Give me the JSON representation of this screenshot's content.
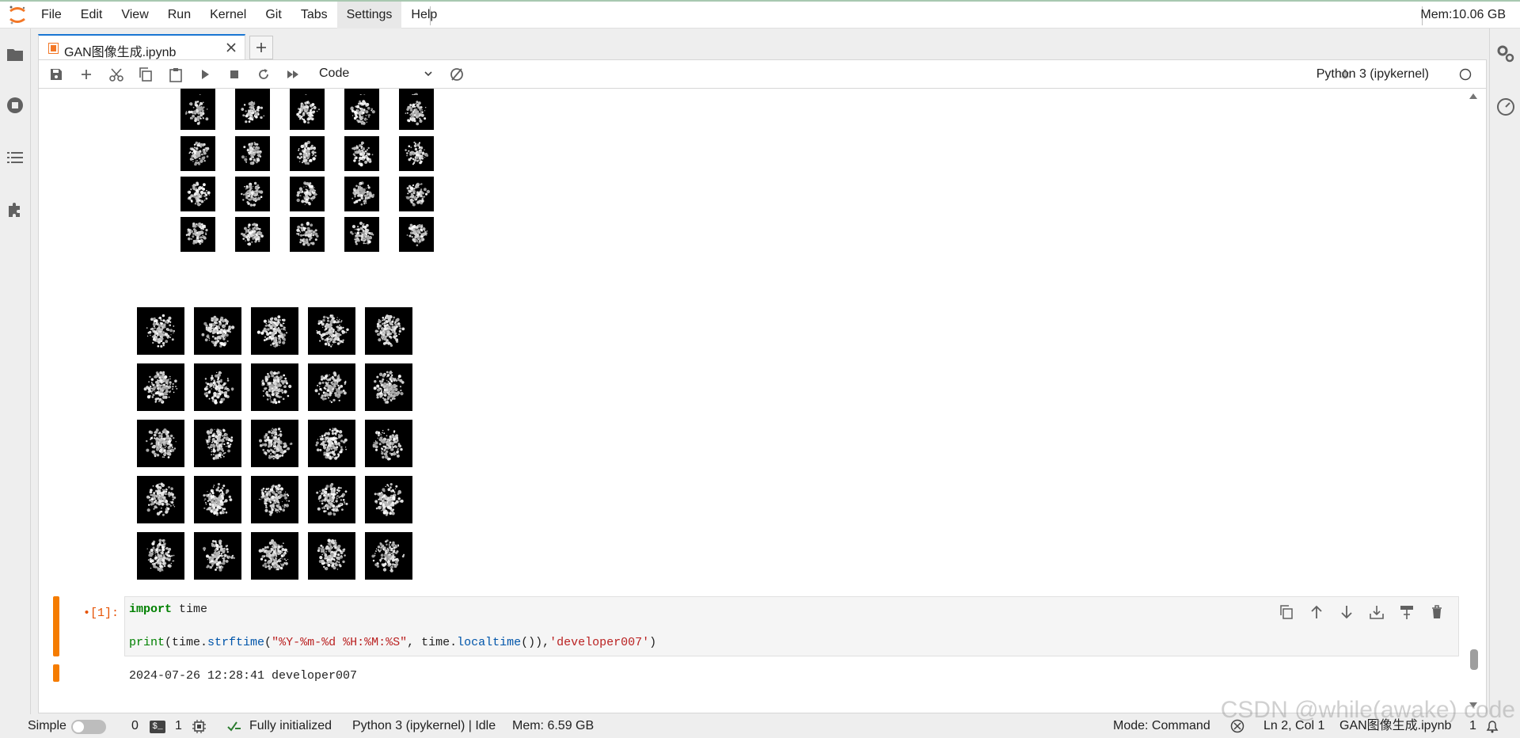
{
  "menubar": {
    "items": [
      "File",
      "Edit",
      "View",
      "Run",
      "Kernel",
      "Git",
      "Tabs",
      "Settings",
      "Help"
    ],
    "memory": "Mem:10.06 GB"
  },
  "tab": {
    "title": "GAN图像生成.ipynb"
  },
  "toolbar": {
    "cell_type": "Code",
    "kernel": "Python 3 (ipykernel)"
  },
  "cell": {
    "prompt": "•[1]:",
    "code_line1_kw": "import",
    "code_line1_rest": " time",
    "code_line2_print": "print",
    "code_line2_a": "(time.",
    "code_line2_fn1": "strftime",
    "code_line2_b": "(",
    "code_line2_str1": "\"%Y-%m-%d %H:%M:%S\"",
    "code_line2_c": ", time.",
    "code_line2_fn2": "localtime",
    "code_line2_d": "()),",
    "code_line2_str2": "'developer007'",
    "code_line2_e": ")",
    "output": "2024-07-26 12:28:41 developer007"
  },
  "statusbar": {
    "mode_label": "Simple",
    "count_a": "0",
    "count_b": "1",
    "init": "Fully initialized",
    "kernel_status": "Python 3 (ipykernel) | Idle",
    "memory": "Mem: 6.59 GB",
    "mode": "Mode: Command",
    "position": "Ln 2, Col 1",
    "filename": "GAN图像生成.ipynb",
    "notifications": "1"
  },
  "watermark": "CSDN @while(awake) code",
  "colors": {
    "accent": "#1976d2",
    "cell_marker": "#f57c00",
    "prompt": "#e65100"
  }
}
